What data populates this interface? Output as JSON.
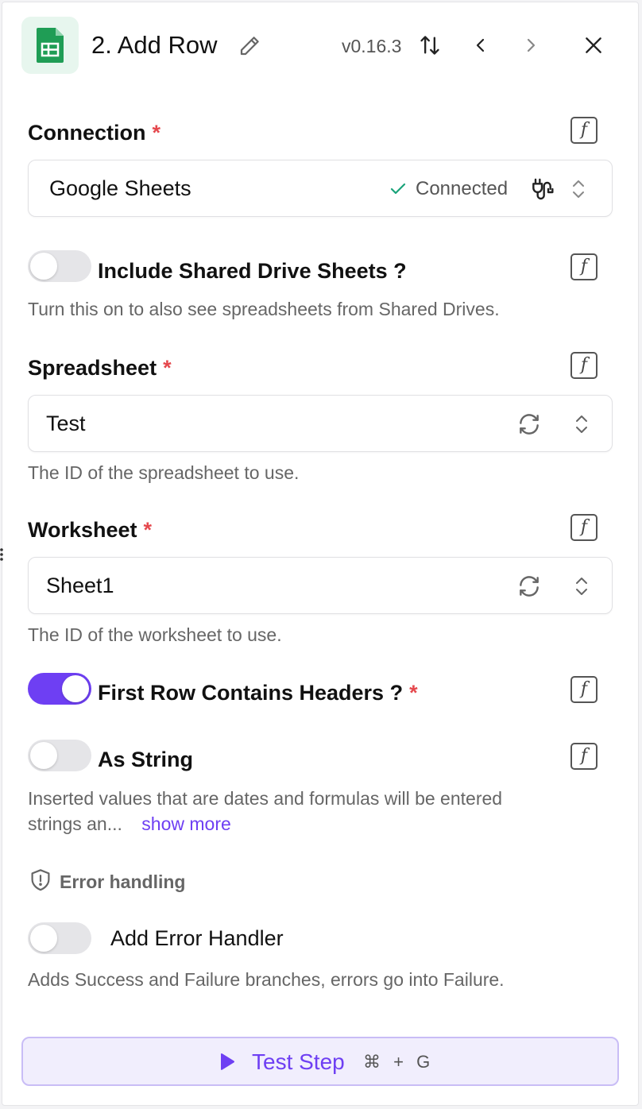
{
  "header": {
    "title": "2. Add Row",
    "version": "v0.16.3",
    "icon": "google-sheets-icon"
  },
  "connection": {
    "label": "Connection",
    "required_mark": "*",
    "value": "Google Sheets",
    "status": "Connected",
    "status_color": "#1aa37a"
  },
  "shared_drive": {
    "label": "Include Shared Drive Sheets ?",
    "hint": "Turn this on to also see spreadsheets from Shared Drives.",
    "on": false
  },
  "spreadsheet": {
    "label": "Spreadsheet",
    "required_mark": "*",
    "value": "Test",
    "hint": "The ID of the spreadsheet to use."
  },
  "worksheet": {
    "label": "Worksheet",
    "required_mark": "*",
    "value": "Sheet1",
    "hint": "The ID of the worksheet to use."
  },
  "first_row_headers": {
    "label": "First Row Contains Headers ?",
    "required_mark": "*",
    "on": true
  },
  "as_string": {
    "label": "As String",
    "hint_line1": "Inserted values that are dates and formulas will be entered",
    "hint_line2": "strings an...",
    "show_more": "show more",
    "on": false
  },
  "error_handling": {
    "heading": "Error handling",
    "toggle_label": "Add Error Handler",
    "hint": "Adds Success and Failure branches, errors go into Failure.",
    "on": false
  },
  "test_step": {
    "label": "Test Step",
    "shortcut_cmd": "⌘",
    "shortcut_plus": "+",
    "shortcut_key": "G"
  },
  "colors": {
    "accent": "#6e3ff3",
    "required": "#e5484d",
    "sheets_green": "#1f9d55"
  }
}
